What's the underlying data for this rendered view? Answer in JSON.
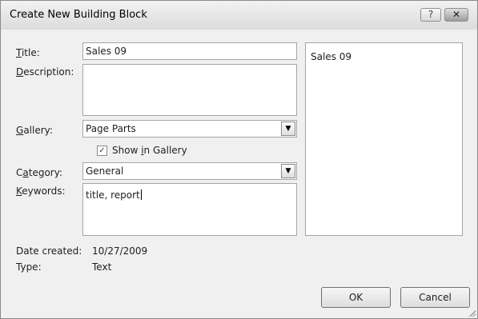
{
  "dialog": {
    "title": "Create New Building Block",
    "help_glyph": "?",
    "close_glyph": "✕"
  },
  "labels": {
    "title": {
      "before": "",
      "key": "T",
      "after": "itle:"
    },
    "description": {
      "before": "",
      "key": "D",
      "after": "escription:"
    },
    "gallery": {
      "before": "",
      "key": "G",
      "after": "allery:"
    },
    "category": {
      "before": "C",
      "key": "a",
      "after": "tegory:"
    },
    "keywords": {
      "before": "",
      "key": "K",
      "after": "eywords:"
    }
  },
  "fields": {
    "title_value": "Sales 09",
    "description_value": "",
    "gallery_value": "Page Parts",
    "show_in_gallery": {
      "checked": true,
      "before": "Show ",
      "key": "i",
      "after": "n Gallery"
    },
    "category_value": "General",
    "keywords_value": "title, report"
  },
  "preview": {
    "text": "Sales 09"
  },
  "info": {
    "date_label": "Date created:",
    "date_value": "10/27/2009",
    "type_label": "Type:",
    "type_value": "Text"
  },
  "buttons": {
    "ok": "OK",
    "cancel": "Cancel"
  },
  "icons": {
    "dropdown_arrow": "▼",
    "checkmark": "✓"
  }
}
